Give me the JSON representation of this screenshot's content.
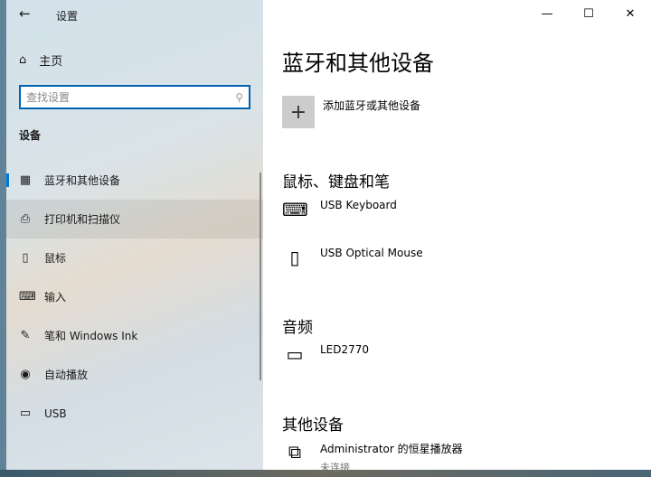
{
  "window": {
    "title": "设置",
    "back": "←",
    "minimize": "—",
    "maximize": "☐",
    "close": "✕"
  },
  "sidebar": {
    "home": "主页",
    "search_placeholder": "查找设置",
    "section": "设备",
    "items": [
      {
        "label": "蓝牙和其他设备",
        "icon": "bluetooth-devices-icon"
      },
      {
        "label": "打印机和扫描仪",
        "icon": "printer-icon"
      },
      {
        "label": "鼠标",
        "icon": "mouse-icon"
      },
      {
        "label": "输入",
        "icon": "keyboard-icon"
      },
      {
        "label": "笔和 Windows Ink",
        "icon": "pen-icon"
      },
      {
        "label": "自动播放",
        "icon": "autoplay-icon"
      },
      {
        "label": "USB",
        "icon": "usb-icon"
      }
    ]
  },
  "main": {
    "title": "蓝牙和其他设备",
    "add_label": "添加蓝牙或其他设备",
    "sections": {
      "mouse_kb": "鼠标、键盘和笔",
      "audio": "音频",
      "other": "其他设备"
    },
    "devices": {
      "keyboard": "USB Keyboard",
      "mouse": "USB Optical Mouse",
      "monitor": "LED2770",
      "player": "Administrator 的恒星播放器",
      "player_status": "未连接"
    }
  }
}
